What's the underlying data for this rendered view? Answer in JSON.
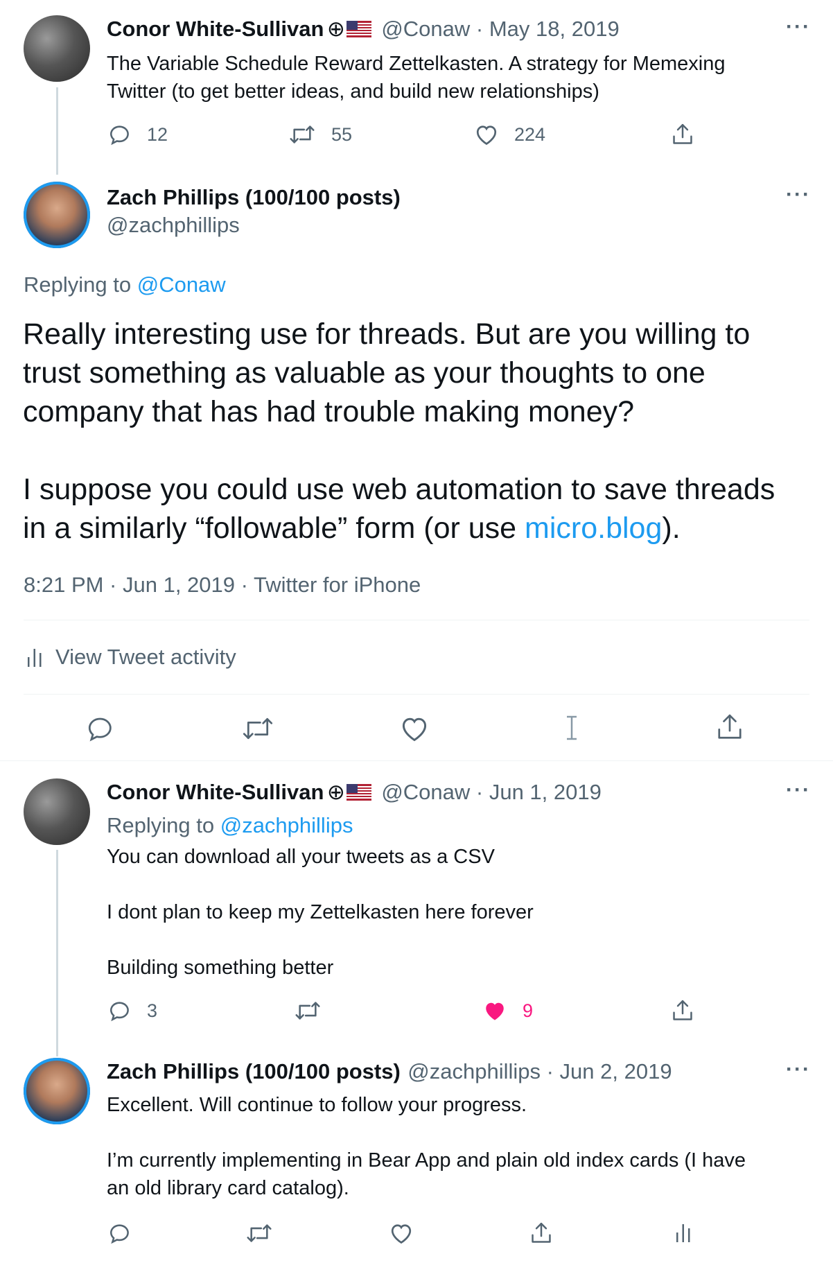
{
  "tweet1": {
    "name": "Conor White-Sullivan",
    "emoji": "⊕",
    "handle_date": "@Conaw · May 18, 2019",
    "text_line1": "The Variable Schedule Reward Zettelkasten. A strategy for Memexing",
    "text_line2": "Twitter (to get better ideas, and build new relationships)",
    "replies": "12",
    "retweets": "55",
    "likes": "224"
  },
  "tweet2": {
    "name": "Zach Phillips (100/100 posts)",
    "handle": "@zachphillips",
    "replying_prefix": "Replying to ",
    "replying_handle": "@Conaw",
    "line1": "Really interesting use for threads. But are you willing to",
    "line2": "trust something as valuable as your thoughts to one",
    "line3": "company that has had trouble making money?",
    "line4": "I suppose you could use web automation to save threads",
    "line5_prefix": "in a similarly “followable” form (or use ",
    "line5_link": "micro.blog",
    "line5_suffix": ").",
    "meta": "8:21 PM · Jun 1, 2019 · Twitter for iPhone",
    "activity_label": "View Tweet activity"
  },
  "tweet3": {
    "name": "Conor White-Sullivan",
    "emoji": "⊕",
    "handle_date": "@Conaw · Jun 1, 2019",
    "replying_prefix": "Replying to ",
    "replying_handle": "@zachphillips",
    "line1": "You can download all your tweets as a CSV",
    "line2": "I dont plan to keep my Zettelkasten here forever",
    "line3": "Building something better",
    "replies": "3",
    "likes": "9"
  },
  "tweet4": {
    "name": "Zach Phillips (100/100 posts)",
    "handle_date": "@zachphillips · Jun 2, 2019",
    "line1": "Excellent. Will continue to follow your progress.",
    "line2": "I’m currently implementing in Bear App and plain old index cards (I have",
    "line3": "an old library card catalog)."
  },
  "colors": {
    "accent": "#1d9bf0",
    "muted": "#536471",
    "like": "#f91880",
    "divider": "#eff3f4"
  },
  "icons": {
    "reply": "reply-icon",
    "retweet": "retweet-icon",
    "like": "heart-icon",
    "share": "share-icon",
    "more": "more-icon",
    "analytics": "analytics-icon",
    "text_cursor": "text-cursor-icon"
  }
}
